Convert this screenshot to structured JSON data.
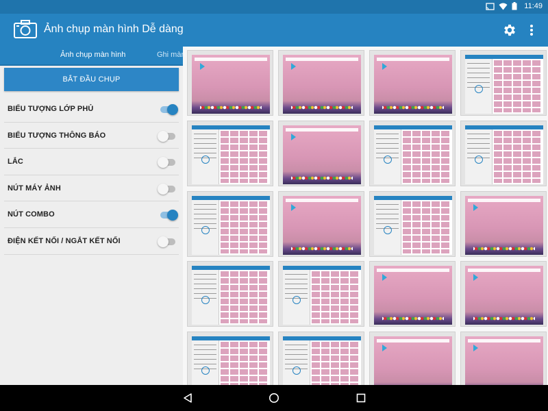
{
  "status_bar": {
    "time": "11:49",
    "icons": [
      "cast-icon",
      "wifi-icon",
      "battery-icon"
    ]
  },
  "app_bar": {
    "title": "Ảnh chụp màn hình Dễ dàng",
    "actions": [
      "gear-icon",
      "overflow-menu-icon"
    ]
  },
  "tabs": [
    {
      "label": "Ảnh chụp màn hình",
      "active": true
    },
    {
      "label": "Ghi màn",
      "active": false
    }
  ],
  "start_button": {
    "label": "BẮT ĐẦU CHỤP"
  },
  "settings": [
    {
      "label": "BIỂU TƯỢNG LỚP PHỦ",
      "enabled": true
    },
    {
      "label": "BIỂU TƯỢNG THÔNG BÁO",
      "enabled": false
    },
    {
      "label": "LẮC",
      "enabled": false
    },
    {
      "label": "NÚT MÁY ẢNH",
      "enabled": false
    },
    {
      "label": "NÚT COMBO",
      "enabled": true
    },
    {
      "label": "ĐIỆN KẾT NỐI / NGẮT KẾT NỐI",
      "enabled": false
    }
  ],
  "gallery": {
    "columns": 4,
    "items": [
      "home-screen",
      "home-screen",
      "home-screen",
      "app-screen",
      "app-screen",
      "home-screen",
      "app-screen",
      "app-screen",
      "app-screen",
      "home-screen",
      "app-screen",
      "home-screen",
      "app-screen",
      "app-screen",
      "home-screen",
      "home-screen",
      "app-screen",
      "app-screen",
      "home-screen",
      "home-screen"
    ]
  },
  "nav_bar": {
    "buttons": [
      "back-icon",
      "home-icon",
      "recents-icon"
    ]
  },
  "colors": {
    "primary": "#2683c1",
    "primary_dark": "#1f74ac",
    "accent_toggle": "#2683c1",
    "panel_bg": "#eeeeee"
  }
}
